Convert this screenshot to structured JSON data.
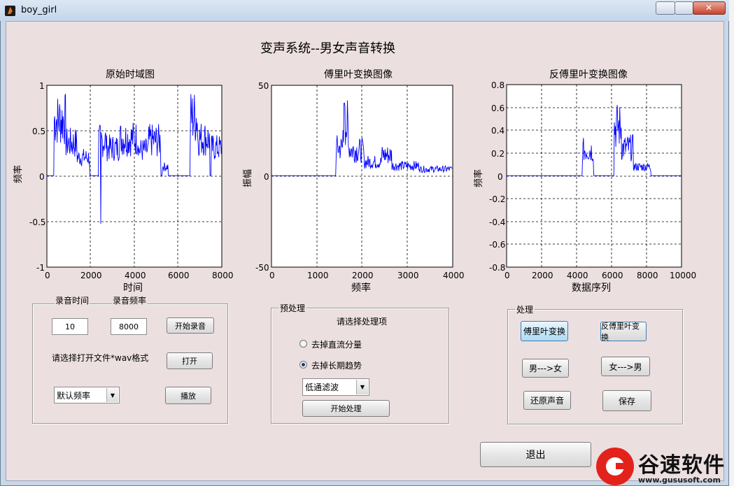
{
  "window": {
    "title": "boy_girl"
  },
  "main_title": "变声系统--男女声音转换",
  "plots": {
    "time": {
      "title": "原始时域图",
      "xlabel": "时间",
      "ylabel": "频率",
      "xticks": [
        "0",
        "2000",
        "4000",
        "6000",
        "8000"
      ],
      "yticks": [
        "1",
        "0.5",
        "0",
        "-0.5",
        "-1"
      ]
    },
    "fft": {
      "title": "傅里叶变换图像",
      "xlabel": "频率",
      "ylabel": "振幅",
      "xticks": [
        "0",
        "1000",
        "2000",
        "3000",
        "4000"
      ],
      "yticks": [
        "50",
        "0",
        "-50"
      ]
    },
    "ifft": {
      "title": "反傅里叶变换图像",
      "xlabel": "数据序列",
      "ylabel": "频率",
      "xticks": [
        "0",
        "2000",
        "4000",
        "6000",
        "8000",
        "10000"
      ],
      "yticks": [
        "0.8",
        "0.6",
        "0.4",
        "0.2",
        "0",
        "-0.2",
        "-0.4",
        "-0.6",
        "-0.8"
      ]
    }
  },
  "record": {
    "time_label": "录音时间",
    "rate_label": "录音频率",
    "time_value": "10",
    "rate_value": "8000",
    "start_button": "开始录音",
    "open_prompt": "请选择打开文件*wav格式",
    "open_button": "打开",
    "rate_select": "默认频率",
    "play_button": "播放"
  },
  "preprocess": {
    "title": "预处理",
    "prompt": "请选择处理项",
    "options": [
      {
        "label": "去掉直流分量",
        "selected": false
      },
      {
        "label": "去掉长期趋势",
        "selected": true
      }
    ],
    "filter_select": "低通滤波",
    "start_button": "开始处理"
  },
  "process": {
    "title": "处理",
    "fft_button": "傅里叶变换",
    "ifft_button": "反傅里叶变换",
    "m2f_button": "男--->女",
    "f2m_button": "女--->男",
    "restore_button": "还原声音",
    "save_button": "保存"
  },
  "exit_button": "退出",
  "watermark": {
    "name": "谷速软件",
    "url": "www.gususoft.com"
  },
  "colors": {
    "signal": "#0000ff",
    "panel_bg": "#ecdfe0"
  }
}
